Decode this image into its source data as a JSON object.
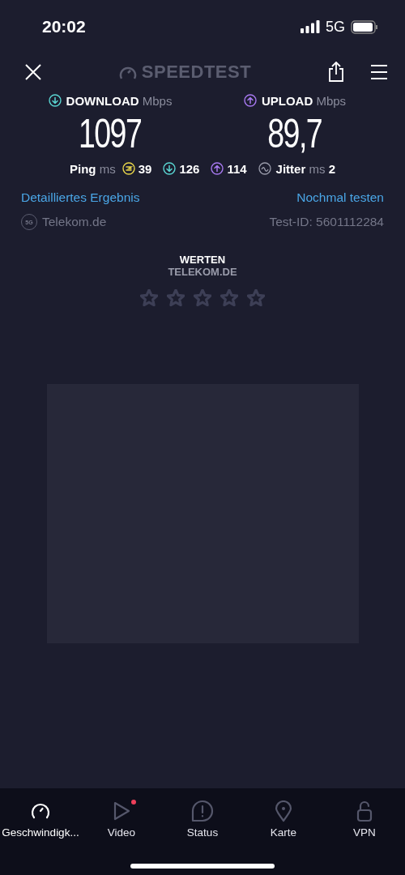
{
  "status_bar": {
    "time": "20:02",
    "network": "5G"
  },
  "header": {
    "logo": "SPEEDTEST"
  },
  "results": [
    {
      "kind": "download",
      "label": "DOWNLOAD",
      "unit": "Mbps",
      "value": "1097"
    },
    {
      "kind": "upload",
      "label": "UPLOAD",
      "unit": "Mbps",
      "value": "89,7"
    }
  ],
  "ping": {
    "label": "Ping",
    "unit": "ms",
    "values": [
      {
        "kind": "idle",
        "value": "39"
      },
      {
        "kind": "download",
        "value": "126"
      },
      {
        "kind": "upload",
        "value": "114"
      }
    ]
  },
  "jitter": {
    "label": "Jitter",
    "unit": "ms",
    "value": "2"
  },
  "links": [
    "Detailliertes Ergebnis",
    "Nochmal testen"
  ],
  "provider": {
    "badge": "5G",
    "name": "Telekom.de"
  },
  "test_id": "Test-ID: 5601112284",
  "rating": {
    "title": "WERTEN",
    "subtitle": "TELEKOM.DE",
    "stars": 0
  },
  "tabs": [
    {
      "kind": "speed",
      "label": "Geschwindigk...",
      "selected": true,
      "notification": false
    },
    {
      "kind": "video",
      "label": "Video",
      "selected": false,
      "notification": true
    },
    {
      "kind": "status",
      "label": "Status",
      "selected": false,
      "notification": false
    },
    {
      "kind": "map",
      "label": "Karte",
      "selected": false,
      "notification": false
    },
    {
      "kind": "vpn",
      "label": "VPN",
      "selected": false,
      "notification": false
    }
  ]
}
